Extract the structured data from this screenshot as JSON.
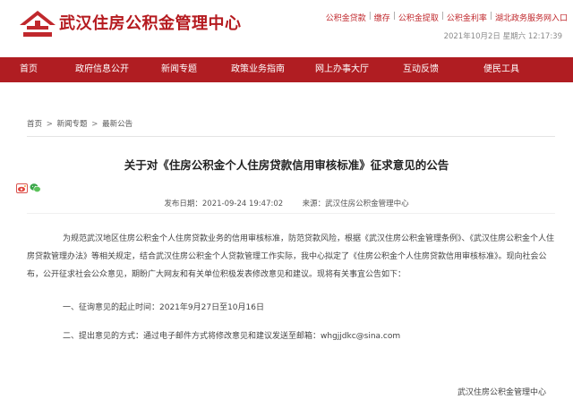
{
  "header": {
    "site_name": "武汉住房公积金管理中心",
    "quick_links": [
      "公积金贷款",
      "缴存",
      "公积金提取",
      "公积金利率",
      "湖北政务服务网入口"
    ],
    "datetime": "2021年10月2日 星期六 12:17:39"
  },
  "nav": {
    "items": [
      "首页",
      "政府信息公开",
      "新闻专题",
      "政策业务指南",
      "网上办事大厅",
      "互动反馈",
      "便民工具"
    ]
  },
  "breadcrumb": [
    "首页",
    "新闻专题",
    "最新公告"
  ],
  "breadcrumb_separator": ">",
  "article": {
    "title": "关于对《住房公积金个人住房贷款信用审核标准》征求意见的公告",
    "publish_label": "发布日期：",
    "publish_date": "2021-09-24 19:47:02",
    "source_label": "来源：",
    "source": "武汉住房公积金管理中心",
    "paragraphs": [
      "为规范武汉地区住房公积金个人住房贷款业务的信用审核标准，防范贷款风险，根据《武汉住房公积金管理条例》、《武汉住房公积金个人住房贷款管理办法》等相关规定，结合武汉住房公积金个人贷款管理工作实际，我中心拟定了《住房公积金个人住房贷款信用审核标准》。现向社会公布，公开征求社会公众意见，期盼广大网友和有关单位积极发表修改意见和建议。现将有关事宜公告如下：",
      "一、征询意见的起止时间：2021年9月27日至10月16日",
      "二、提出意见的方式：通过电子邮件方式将修改意见和建议发送至邮箱：whgjjdkc@sina.com"
    ],
    "signature": "武汉住房公积金管理中心"
  },
  "colors": {
    "brand_red": "#b01d22",
    "link_red": "#c0282d"
  },
  "icons": [
    "house-logo-icon",
    "weibo-share-icon",
    "wechat-share-icon"
  ]
}
